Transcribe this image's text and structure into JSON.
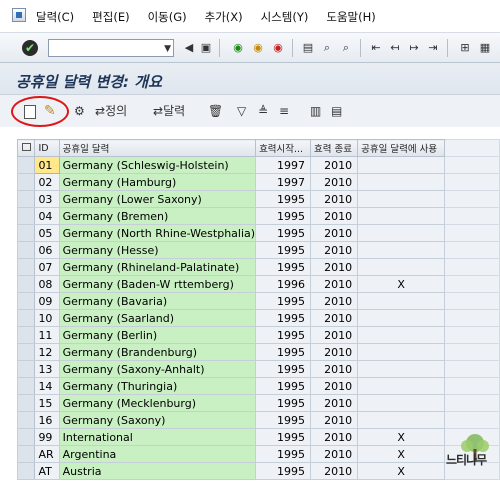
{
  "menu": {
    "items": [
      "달력(C)",
      "편집(E)",
      "이동(G)",
      "추가(X)",
      "시스템(Y)",
      "도움말(H)"
    ]
  },
  "toolbar": {
    "command_field_value": "",
    "icons": [
      "enter-check-icon",
      "command-dropdown-icon",
      "back-arrow-icon",
      "save-icon",
      "back-icon",
      "exit-icon",
      "cancel-icon",
      "print-icon",
      "find-icon",
      "find-next-icon",
      "first-page-icon",
      "prev-page-icon",
      "next-page-icon",
      "last-page-icon",
      "new-session-icon",
      "shortcut-icon"
    ]
  },
  "page": {
    "title": "공휴일 달력 변경: 개요"
  },
  "app_toolbar": {
    "definition_label": "정의",
    "calendar_label": "달력"
  },
  "table": {
    "headers": [
      "ID",
      "공휴일 달력",
      "효력시작...",
      "효력 종료",
      "공휴일 달력에 사용"
    ],
    "rows": [
      {
        "id": "01",
        "name": "Germany (Schleswig-Holstein)",
        "from": "1997",
        "to": "2010",
        "used": ""
      },
      {
        "id": "02",
        "name": "Germany (Hamburg)",
        "from": "1997",
        "to": "2010",
        "used": ""
      },
      {
        "id": "03",
        "name": "Germany (Lower Saxony)",
        "from": "1995",
        "to": "2010",
        "used": ""
      },
      {
        "id": "04",
        "name": "Germany (Bremen)",
        "from": "1995",
        "to": "2010",
        "used": ""
      },
      {
        "id": "05",
        "name": "Germany (North Rhine-Westphalia)",
        "from": "1995",
        "to": "2010",
        "used": ""
      },
      {
        "id": "06",
        "name": "Germany (Hesse)",
        "from": "1995",
        "to": "2010",
        "used": ""
      },
      {
        "id": "07",
        "name": "Germany (Rhineland-Palatinate)",
        "from": "1995",
        "to": "2010",
        "used": ""
      },
      {
        "id": "08",
        "name": "Germany (Baden-W    rttemberg)",
        "from": "1996",
        "to": "2010",
        "used": "X"
      },
      {
        "id": "09",
        "name": "Germany (Bavaria)",
        "from": "1995",
        "to": "2010",
        "used": ""
      },
      {
        "id": "10",
        "name": "Germany (Saarland)",
        "from": "1995",
        "to": "2010",
        "used": ""
      },
      {
        "id": "11",
        "name": "Germany (Berlin)",
        "from": "1995",
        "to": "2010",
        "used": ""
      },
      {
        "id": "12",
        "name": "Germany (Brandenburg)",
        "from": "1995",
        "to": "2010",
        "used": ""
      },
      {
        "id": "13",
        "name": "Germany (Saxony-Anhalt)",
        "from": "1995",
        "to": "2010",
        "used": ""
      },
      {
        "id": "14",
        "name": "Germany (Thuringia)",
        "from": "1995",
        "to": "2010",
        "used": ""
      },
      {
        "id": "15",
        "name": "Germany (Mecklenburg)",
        "from": "1995",
        "to": "2010",
        "used": ""
      },
      {
        "id": "16",
        "name": "Germany (Saxony)",
        "from": "1995",
        "to": "2010",
        "used": ""
      },
      {
        "id": "99",
        "name": "International",
        "from": "1995",
        "to": "2010",
        "used": "X"
      },
      {
        "id": "AR",
        "name": "Argentina",
        "from": "1995",
        "to": "2010",
        "used": "X"
      },
      {
        "id": "AT",
        "name": "Austria",
        "from": "1995",
        "to": "2010",
        "used": "X"
      }
    ]
  },
  "watermark": {
    "text": "느티나무",
    "icon": "tree-logo-icon"
  },
  "colors": {
    "highlight_circle": "#e01515",
    "name_cell_bg": "#c9f0c3",
    "selected_id_bg": "#ffe88a",
    "title_color": "#1f3557"
  }
}
